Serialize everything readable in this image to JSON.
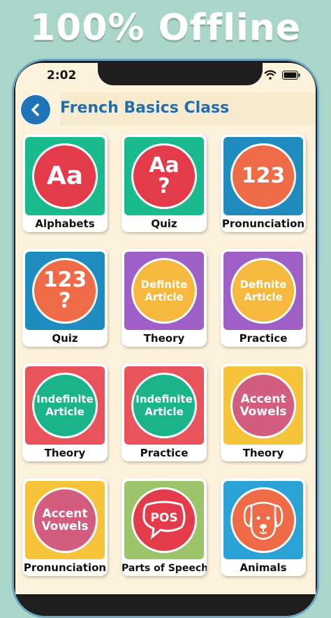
{
  "promo": {
    "headline": "100% Offline"
  },
  "status_bar": {
    "time": "2:02"
  },
  "header": {
    "title": "French Basics Class"
  },
  "colors": {
    "green": "#1bb98e",
    "blue": "#1f8bbf",
    "purple": "#9e5fc6",
    "red": "#e8535c",
    "yellow": "#f6c43b",
    "light_blue": "#2ba3d6",
    "olive": "#9cc46a",
    "circle_red": "#e43b4b",
    "circle_orange": "#ef6a47",
    "circle_yellow": "#f6b83e",
    "circle_green": "#1bb48a",
    "circle_pink": "#d35d7f"
  },
  "cards": [
    {
      "label": "Alphabets",
      "line1": "Aa",
      "line2": ""
    },
    {
      "label": "Quiz",
      "line1": "Aa",
      "line2": "?"
    },
    {
      "label": "Pronunciation",
      "line1": "123",
      "line2": ""
    },
    {
      "label": "Quiz",
      "line1": "123",
      "line2": "?"
    },
    {
      "label": "Theory",
      "line1": "Definite",
      "line2": "Article"
    },
    {
      "label": "Practice",
      "line1": "Definite",
      "line2": "Article"
    },
    {
      "label": "Theory",
      "line1": "Indefinite",
      "line2": "Article"
    },
    {
      "label": "Practice",
      "line1": "Indefinite",
      "line2": "Article"
    },
    {
      "label": "Theory",
      "line1": "Accent",
      "line2": "Vowels"
    },
    {
      "label": "Pronunciation",
      "line1": "Accent",
      "line2": "Vowels"
    },
    {
      "label": "Parts of Speech",
      "line1": "POS",
      "line2": "",
      "icon": "speech-bubble-icon"
    },
    {
      "label": "Animals",
      "line1": "",
      "line2": "",
      "icon": "dog-face-icon"
    }
  ]
}
